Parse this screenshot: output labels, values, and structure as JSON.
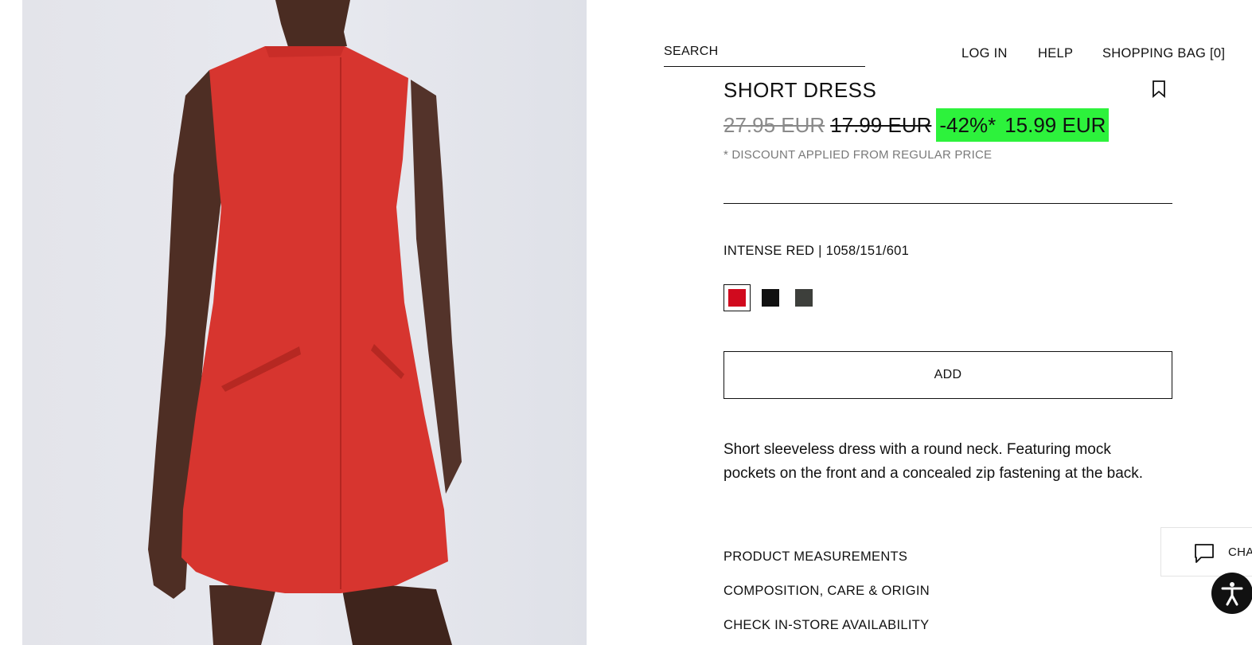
{
  "header": {
    "search_label": "SEARCH",
    "login_label": "LOG IN",
    "help_label": "HELP",
    "bag_label": "SHOPPING BAG [0]"
  },
  "product": {
    "title": "SHORT DRESS",
    "original_price": "27.95 EUR",
    "previous_price": "17.99 EUR",
    "discount": "-42%*",
    "current_price": "15.99 EUR",
    "discount_note": "* DISCOUNT APPLIED FROM REGULAR PRICE",
    "color_reference": "INTENSE RED | 1058/151/601",
    "swatches": [
      {
        "color": "#d10a1e",
        "selected": true
      },
      {
        "color": "#111111",
        "selected": false
      },
      {
        "color": "#3d3f3b",
        "selected": false
      }
    ],
    "add_label": "ADD",
    "description": "Short sleeveless dress with a round neck. Featuring mock pockets on the front and a concealed zip fastening at the back.",
    "sections": [
      "PRODUCT MEASUREMENTS",
      "COMPOSITION, CARE & ORIGIN",
      "CHECK IN-STORE AVAILABILITY"
    ]
  },
  "chat": {
    "label": "CHAT"
  },
  "colors": {
    "accent_discount": "#2df23c",
    "text": "#111111",
    "muted": "#8a8a8a"
  },
  "icons": {
    "bookmark": "bookmark-icon",
    "chat": "chat-icon",
    "accessibility": "accessibility-icon"
  }
}
